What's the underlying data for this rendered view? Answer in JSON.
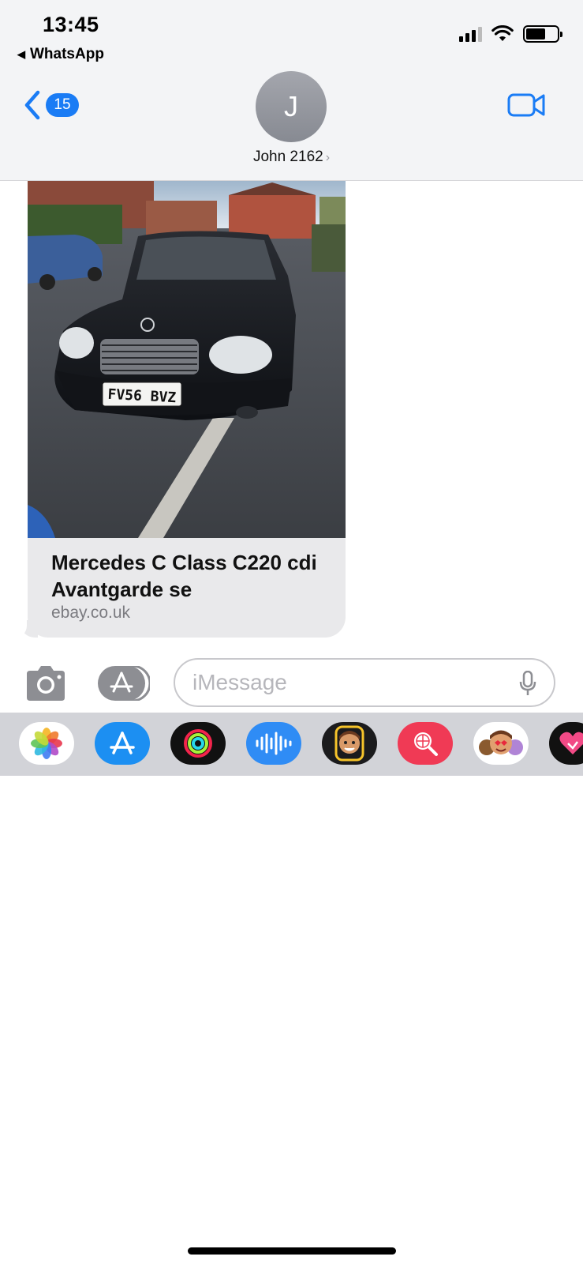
{
  "status_bar": {
    "time": "13:45",
    "back_app": "WhatsApp"
  },
  "header": {
    "back_badge": "15",
    "avatar_initial": "J",
    "contact_name": "John 2162",
    "contact_chevron": "›"
  },
  "message": {
    "link_preview": {
      "image": "black-mercedes-car-photo",
      "plate": "FV56 BVZ",
      "title": "Mercedes C Class C220 cdi Avantgarde se",
      "domain": "ebay.co.uk"
    }
  },
  "composer": {
    "placeholder": "iMessage"
  },
  "app_drawer": [
    "photos-app",
    "app-store-app",
    "activity-app",
    "audio-app",
    "memoji-app",
    "images-search-app",
    "memoji-stickers-app",
    "digital-touch-app"
  ],
  "colors": {
    "accent": "#1a7cf5",
    "bubble": "#e9e9eb",
    "drawer": "#d2d3d8"
  }
}
